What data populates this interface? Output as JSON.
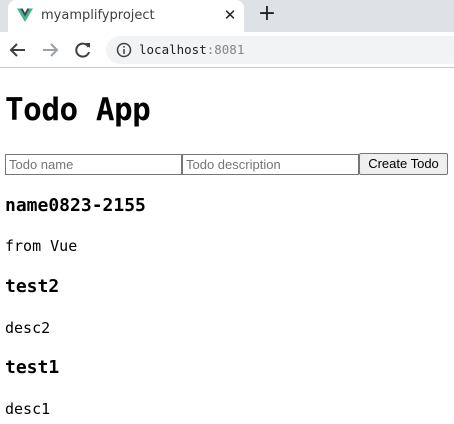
{
  "browser": {
    "tab": {
      "title": "myamplifyproject",
      "favicon": "vue-logo-icon",
      "close_glyph": "✕"
    },
    "new_tab_glyph": "+",
    "nav": {
      "back": "arrow-left-icon",
      "forward": "arrow-right-icon",
      "reload": "reload-icon"
    },
    "address_bar": {
      "host": "localhost",
      "port": ":8081",
      "icon": "info-icon"
    }
  },
  "app": {
    "title": "Todo App",
    "form": {
      "name_placeholder": "Todo name",
      "name_value": "",
      "description_placeholder": "Todo description",
      "description_value": "",
      "submit_label": "Create Todo"
    },
    "todos": [
      {
        "name": "name0823-2155",
        "description": "from Vue"
      },
      {
        "name": "test2",
        "description": "desc2"
      },
      {
        "name": "test1",
        "description": "desc1"
      }
    ]
  },
  "colors": {
    "tabstrip": "#dee1e6",
    "omnibox": "#f1f3f4",
    "vue_green": "#41b883",
    "vue_dark": "#35495e"
  }
}
